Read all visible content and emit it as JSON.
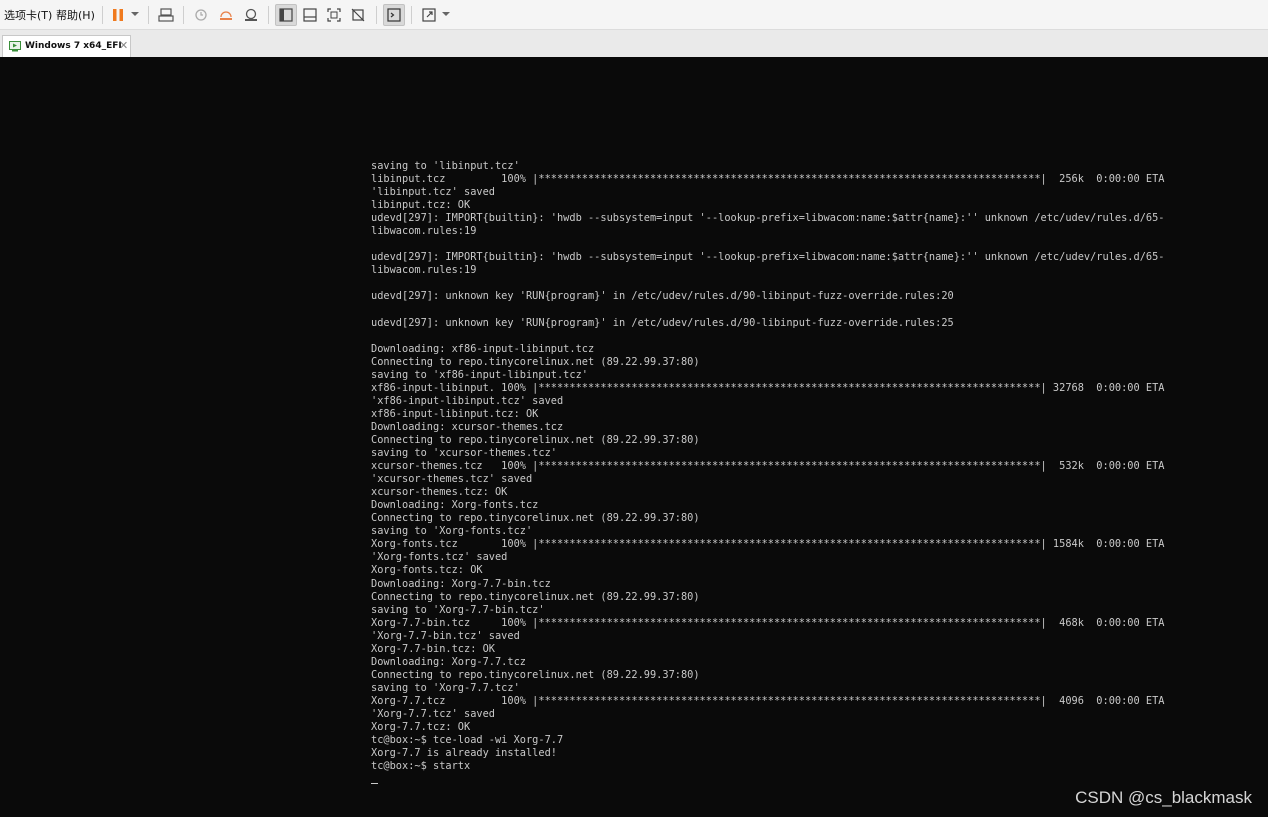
{
  "menu": {
    "tabs_label": "选项卡(T)",
    "help_label": "帮助(H)"
  },
  "toolbar": {
    "icons": [
      "pause-icon",
      "send-keys-icon",
      "snapshot-icon",
      "revert-snapshot-icon",
      "snapshot-manager-icon",
      "console-view-icon",
      "unity-icon",
      "fullscreen-icon",
      "no-scale-icon",
      "terminal-icon",
      "stretch-icon"
    ],
    "pause_color": "#f07a1e"
  },
  "tab": {
    "title": "Windows 7 x64_EFI",
    "close": "✕"
  },
  "console": {
    "lines": [
      "saving to 'libinput.tcz'",
      "libinput.tcz         100% |*********************************************************************************|  256k  0:00:00 ETA",
      "'libinput.tcz' saved",
      "libinput.tcz: OK",
      "udevd[297]: IMPORT{builtin}: 'hwdb --subsystem=input '--lookup-prefix=libwacom:name:$attr{name}:'' unknown /etc/udev/rules.d/65-",
      "libwacom.rules:19",
      "",
      "udevd[297]: IMPORT{builtin}: 'hwdb --subsystem=input '--lookup-prefix=libwacom:name:$attr{name}:'' unknown /etc/udev/rules.d/65-",
      "libwacom.rules:19",
      "",
      "udevd[297]: unknown key 'RUN{program}' in /etc/udev/rules.d/90-libinput-fuzz-override.rules:20",
      "",
      "udevd[297]: unknown key 'RUN{program}' in /etc/udev/rules.d/90-libinput-fuzz-override.rules:25",
      "",
      "Downloading: xf86-input-libinput.tcz",
      "Connecting to repo.tinycorelinux.net (89.22.99.37:80)",
      "saving to 'xf86-input-libinput.tcz'",
      "xf86-input-libinput. 100% |*********************************************************************************| 32768  0:00:00 ETA",
      "'xf86-input-libinput.tcz' saved",
      "xf86-input-libinput.tcz: OK",
      "Downloading: xcursor-themes.tcz",
      "Connecting to repo.tinycorelinux.net (89.22.99.37:80)",
      "saving to 'xcursor-themes.tcz'",
      "xcursor-themes.tcz   100% |*********************************************************************************|  532k  0:00:00 ETA",
      "'xcursor-themes.tcz' saved",
      "xcursor-themes.tcz: OK",
      "Downloading: Xorg-fonts.tcz",
      "Connecting to repo.tinycorelinux.net (89.22.99.37:80)",
      "saving to 'Xorg-fonts.tcz'",
      "Xorg-fonts.tcz       100% |*********************************************************************************| 1584k  0:00:00 ETA",
      "'Xorg-fonts.tcz' saved",
      "Xorg-fonts.tcz: OK",
      "Downloading: Xorg-7.7-bin.tcz",
      "Connecting to repo.tinycorelinux.net (89.22.99.37:80)",
      "saving to 'Xorg-7.7-bin.tcz'",
      "Xorg-7.7-bin.tcz     100% |*********************************************************************************|  468k  0:00:00 ETA",
      "'Xorg-7.7-bin.tcz' saved",
      "Xorg-7.7-bin.tcz: OK",
      "Downloading: Xorg-7.7.tcz",
      "Connecting to repo.tinycorelinux.net (89.22.99.37:80)",
      "saving to 'Xorg-7.7.tcz'",
      "Xorg-7.7.tcz         100% |*********************************************************************************|  4096  0:00:00 ETA",
      "'Xorg-7.7.tcz' saved",
      "Xorg-7.7.tcz: OK",
      "tc@box:~$ tce-load -wi Xorg-7.7",
      "Xorg-7.7 is already installed!",
      "tc@box:~$ startx",
      ""
    ]
  },
  "watermark": "CSDN @cs_blackmask"
}
